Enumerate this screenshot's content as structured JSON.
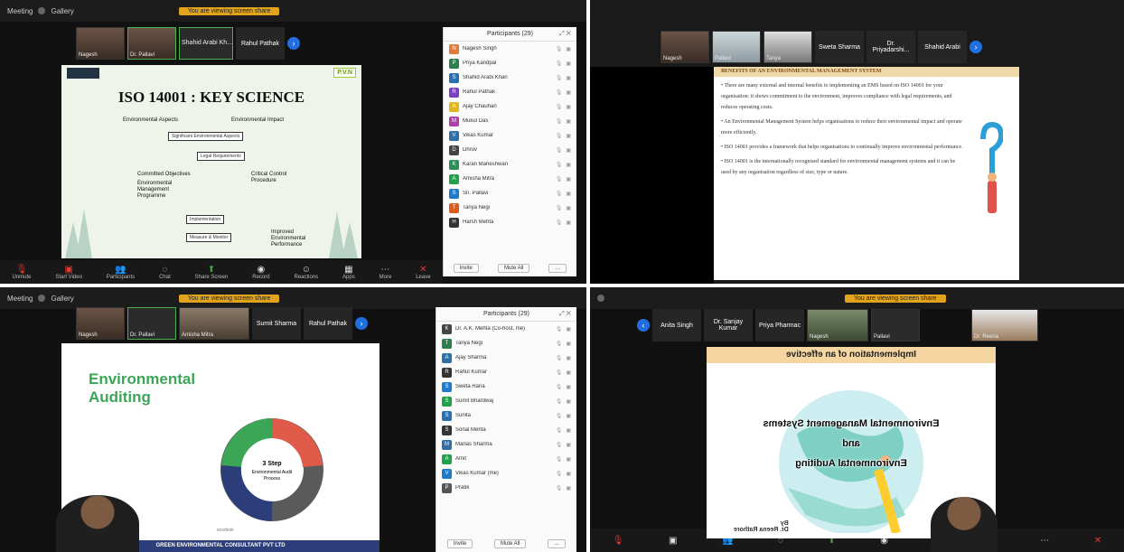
{
  "q1": {
    "topbar": {
      "meeting_label": "Meeting",
      "view_label": "Gallery",
      "share_label": "You are viewing screen share"
    },
    "strip": [
      {
        "name": "Nagesh"
      },
      {
        "name": "Dr. Pallavi"
      },
      {
        "name": "Shahid Arabi Kh...",
        "type": "name"
      },
      {
        "name": "Rahul Pathak",
        "type": "name"
      }
    ],
    "slide": {
      "logo": "P.V.N",
      "title": "ISO 14001 : KEY SCIENCE",
      "left_label": "Environmental Aspects",
      "right_label": "Environmental Impact",
      "box1": "Significant Environmental Aspects",
      "box2": "Legal Requirements",
      "l1": "Committed Objectives",
      "l2": "Environmental Management Programme",
      "r1": "Critical Control Procedure",
      "box3": "Implementation",
      "box4": "Measure & Monitor",
      "out": "Improved Environmental Performance"
    },
    "panel": {
      "title": "Participants (29)",
      "rows": [
        {
          "init": "N",
          "name": "Nagesh Singh",
          "color": "#e07b39"
        },
        {
          "init": "P",
          "name": "Priya Kandpal",
          "color": "#2e7d4f"
        },
        {
          "init": "S",
          "name": "Shahid Arabi Khan",
          "color": "#2a6fb0"
        },
        {
          "init": "R",
          "name": "Rahul Pathak",
          "color": "#7a3fbf"
        },
        {
          "init": "A",
          "name": "Ajay Chauhan",
          "color": "#e0b81b"
        },
        {
          "init": "M",
          "name": "Mukul Das",
          "color": "#b03fae"
        },
        {
          "init": "V",
          "name": "Vikas Kumar",
          "color": "#2f6fa8"
        },
        {
          "init": "D",
          "name": "Dhruv",
          "color": "#444444"
        },
        {
          "init": "K",
          "name": "Karan Maheshwari",
          "color": "#2d8f5a"
        },
        {
          "init": "A",
          "name": "Amisha Mitra",
          "color": "#23a04a"
        },
        {
          "init": "S",
          "name": "Sn. Pallavi",
          "color": "#1f7ac9"
        },
        {
          "init": "T",
          "name": "Tanya Negi",
          "color": "#e05a1b"
        },
        {
          "init": "H",
          "name": "Harsh Mehta",
          "color": "#333333"
        }
      ],
      "invite": "Invite",
      "mute": "Mute All"
    },
    "controls": [
      "Unmute",
      "Start Video",
      "Participants",
      "Chat",
      "Share Screen",
      "Record",
      "Reactions",
      "Apps",
      "More",
      "Leave"
    ]
  },
  "q2": {
    "strip": [
      {
        "name": "Nagesh"
      },
      {
        "name": "Pallavi"
      },
      {
        "name": "Tanya"
      },
      {
        "name": "Sweta Sharma",
        "type": "name"
      },
      {
        "name": "Dr. Priyadarshi...",
        "type": "name"
      },
      {
        "name": "Shahid Arabi",
        "type": "name"
      }
    ],
    "slide": {
      "header": "BENEFITS OF AN ENVIRONMENTAL MANAGEMENT SYSTEM",
      "bullets": [
        "There are many external and internal benefits to implementing an EMS based on ISO 14001 for your organisation: it shows commitment to the environment, improves compliance with legal requirements, and reduces operating costs.",
        "An Environmental Management System helps organisations to reduce their environmental impact and operate more efficiently.",
        "ISO 14001 provides a framework that helps organisations to continually improve environmental performance.",
        "ISO 14001 is the internationally recognised standard for environmental management systems and it can be used by any organisation regardless of size, type or nature."
      ]
    }
  },
  "q3": {
    "topbar": {
      "meeting_label": "Meeting",
      "view_label": "Gallery",
      "share_label": "You are viewing screen share"
    },
    "strip": [
      {
        "name": "Nagesh"
      },
      {
        "name": "Dr. Pallavi"
      },
      {
        "name": "Amisha Mitra"
      },
      {
        "name": "Sumit Sharma",
        "type": "name"
      },
      {
        "name": "Rahul Pathak",
        "type": "name"
      }
    ],
    "slide": {
      "title1": "Environmental",
      "title2": "Auditing",
      "center1": "3 Step",
      "center2": "Environmental Audit",
      "center3": "Process",
      "footer": "GREEN ENVIRONMENTAL CONSULTANT PVT LTD",
      "caption": "ecodesk"
    },
    "panel": {
      "title": "Participants (29)",
      "rows": [
        {
          "init": "K",
          "name": "Dr. A.K. Mehta (Co-host, me)",
          "color": "#444"
        },
        {
          "init": "T",
          "name": "Tanya Negi",
          "color": "#2e7d4f"
        },
        {
          "init": "A",
          "name": "Ajay Sharma",
          "color": "#2f6fa8"
        },
        {
          "init": "R",
          "name": "Rahul Kumar",
          "color": "#333"
        },
        {
          "init": "S",
          "name": "Sweta Rana",
          "color": "#1f7ac9"
        },
        {
          "init": "S",
          "name": "Sumit Bhardwaj",
          "color": "#23a04a"
        },
        {
          "init": "S",
          "name": "Sunita",
          "color": "#2a6fb0"
        },
        {
          "init": "S",
          "name": "Sonal Mehta",
          "color": "#333"
        },
        {
          "init": "M",
          "name": "Manas Sharma",
          "color": "#2f6fa8"
        },
        {
          "init": "A",
          "name": "Amit",
          "color": "#23a04a"
        },
        {
          "init": "V",
          "name": "Vikas Kumar (me)",
          "color": "#1f7ac9"
        },
        {
          "init": "P",
          "name": "Pratik",
          "color": "#555"
        }
      ],
      "invite": "Invite",
      "mute": "Mute All"
    }
  },
  "q4": {
    "topbar": {
      "share_label": "You are viewing screen share"
    },
    "strip": [
      {
        "name": "Anita Singh",
        "type": "name"
      },
      {
        "name": "Dr. Sanjay Kumar",
        "type": "name"
      },
      {
        "name": "Priya Pharmac",
        "type": "name"
      },
      {
        "name": "Nagesh"
      },
      {
        "name": "Pallavi"
      },
      {
        "name": "Dr. Reena"
      }
    ],
    "slide": {
      "header": "Implementation of an effective",
      "line1": "Environmental Management Systems",
      "line2": "and",
      "line3": "Environmental Auditing",
      "by1": "By",
      "by2": "Dr. Reena Rathore"
    }
  }
}
